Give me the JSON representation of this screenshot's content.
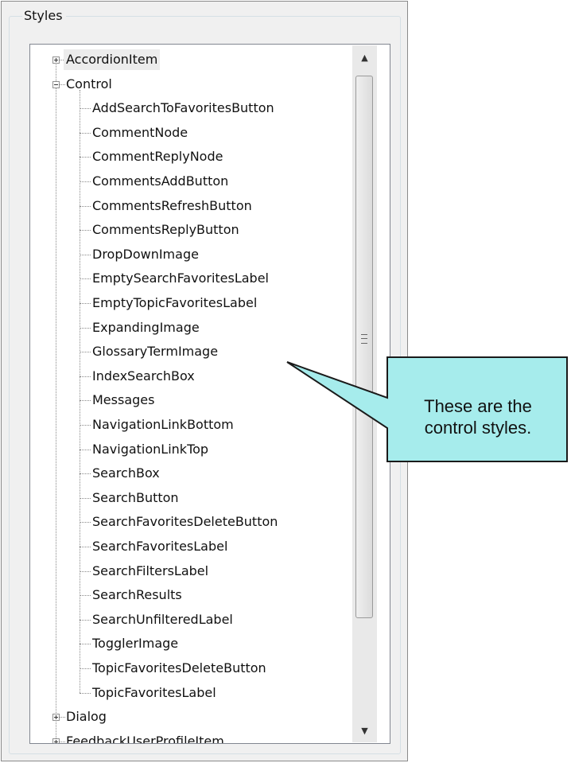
{
  "group": {
    "title": "Styles"
  },
  "tree": {
    "top_nodes": [
      {
        "label": "AccordionItem",
        "expanded": false,
        "selected": true
      },
      {
        "label": "Control",
        "expanded": true
      },
      {
        "label": "Dialog",
        "expanded": false
      },
      {
        "label": "FeedbackUserProfileItem",
        "expanded": false
      }
    ],
    "control_children": [
      "AddSearchToFavoritesButton",
      "CommentNode",
      "CommentReplyNode",
      "CommentsAddButton",
      "CommentsRefreshButton",
      "CommentsReplyButton",
      "DropDownImage",
      "EmptySearchFavoritesLabel",
      "EmptyTopicFavoritesLabel",
      "ExpandingImage",
      "GlossaryTermImage",
      "IndexSearchBox",
      "Messages",
      "NavigationLinkBottom",
      "NavigationLinkTop",
      "SearchBox",
      "SearchButton",
      "SearchFavoritesDeleteButton",
      "SearchFavoritesLabel",
      "SearchFiltersLabel",
      "SearchResults",
      "SearchUnfilteredLabel",
      "TogglerImage",
      "TopicFavoritesDeleteButton",
      "TopicFavoritesLabel"
    ]
  },
  "callout": {
    "line1": "These are the",
    "line2": "control styles.",
    "fill": "#a6ecec",
    "stroke": "#1a1a1a"
  },
  "icons": {
    "expand": "plus-box-icon",
    "collapse": "minus-box-icon",
    "scroll_up": "triangle-up-icon",
    "scroll_down": "triangle-down-icon"
  }
}
